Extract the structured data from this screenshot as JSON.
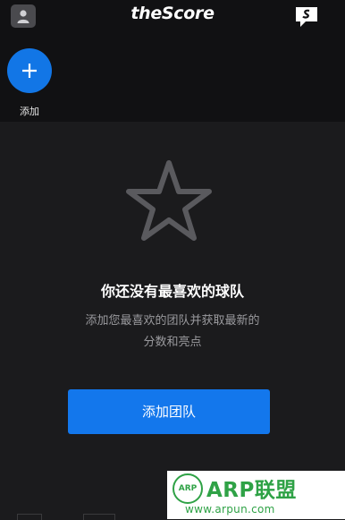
{
  "header": {
    "logo": "theScore"
  },
  "add_section": {
    "label": "添加"
  },
  "empty_state": {
    "title": "你还没有最喜欢的球队",
    "description_line1": "添加您最喜欢的团队并获取最新的",
    "description_line2": "分数和亮点",
    "button_label": "添加团队"
  },
  "watermark": {
    "logo": "ARP",
    "title": "ARP联盟",
    "url": "www.arpun.com"
  },
  "colors": {
    "accent": "#1377ec",
    "background": "#1b1b1d",
    "header": "#111113"
  },
  "icons": [
    "profile-icon",
    "chat-icon",
    "plus-icon",
    "star-icon"
  ]
}
